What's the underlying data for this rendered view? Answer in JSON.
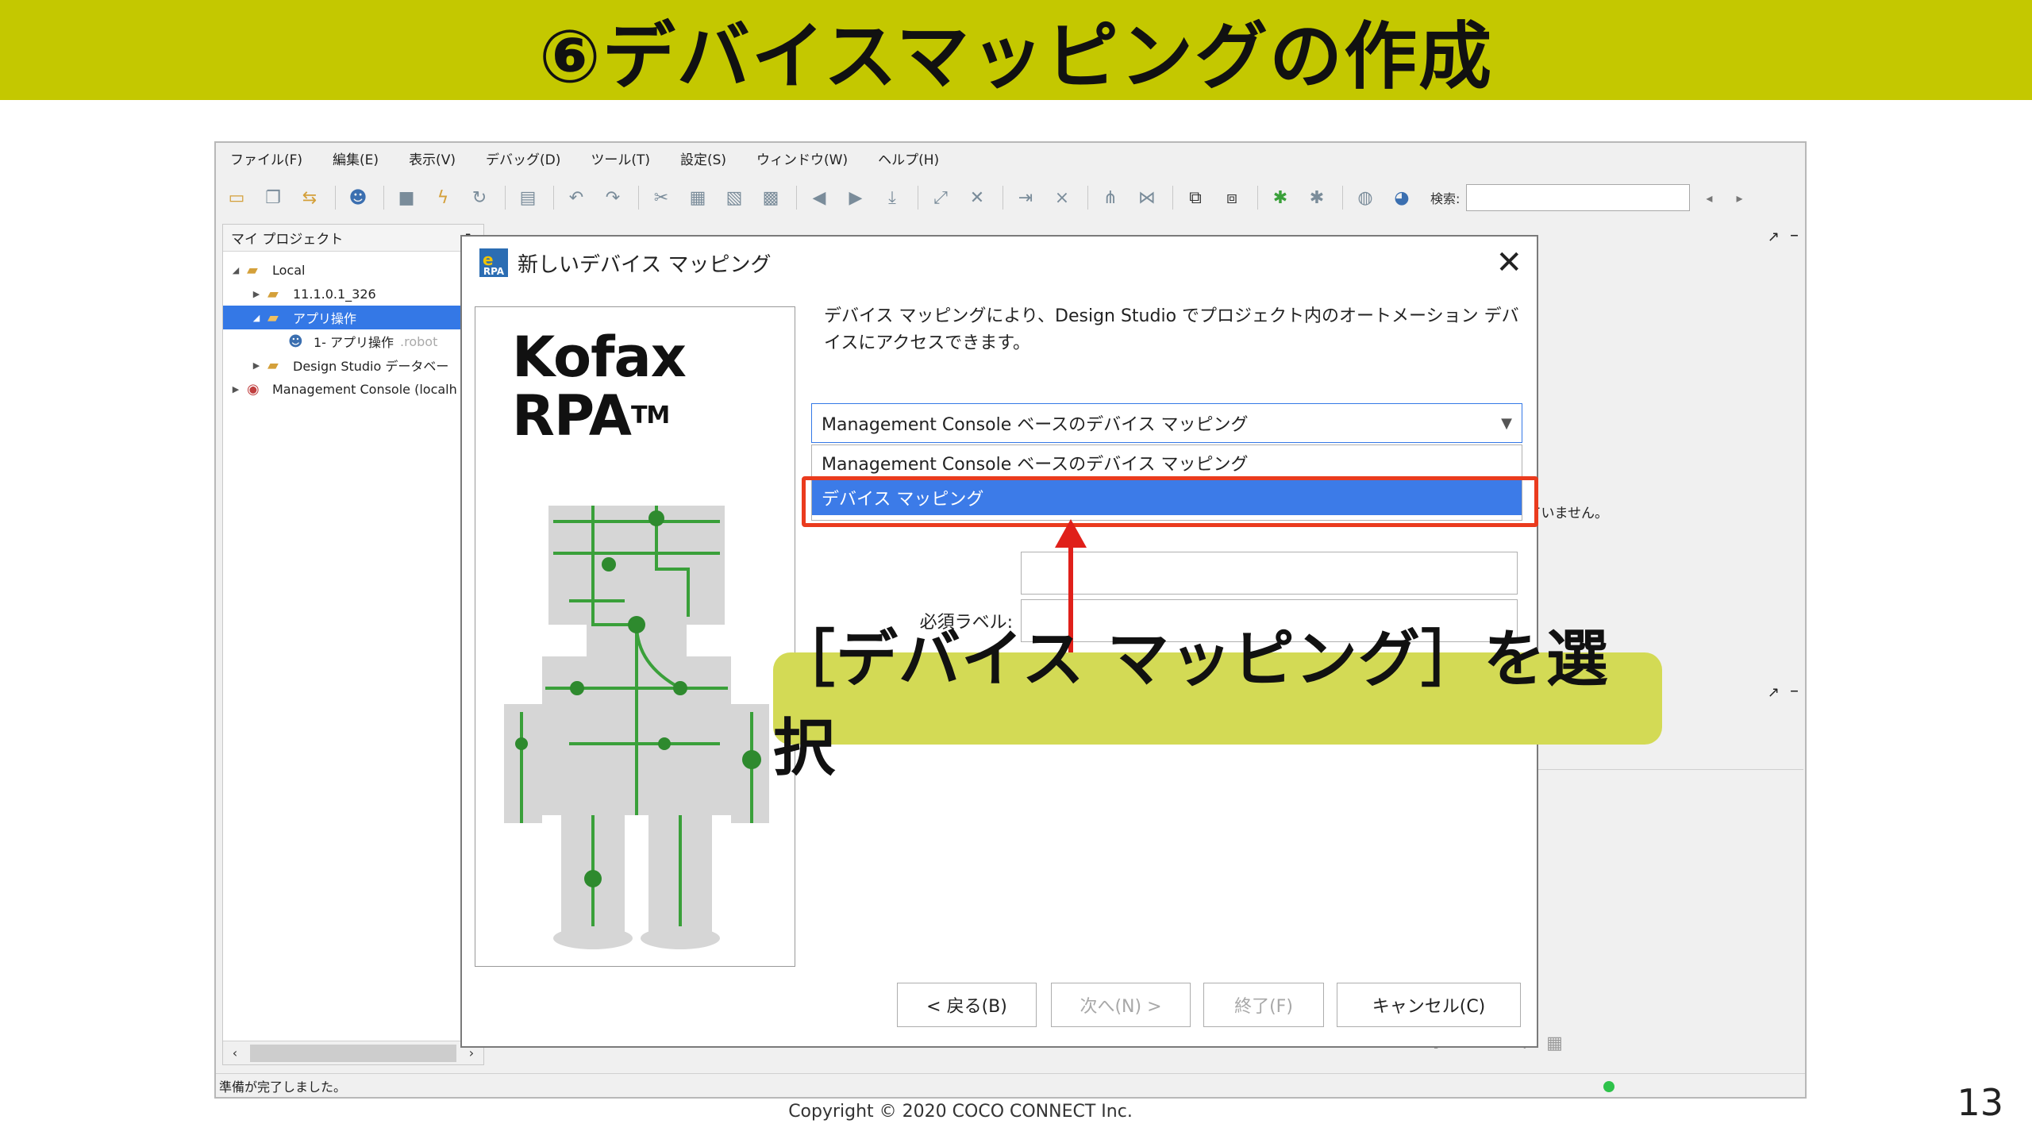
{
  "slide": {
    "title": "⑥デバイスマッピングの作成",
    "copyright": "Copyright © 2020 COCO CONNECT Inc.",
    "page_number": "13",
    "callout": "［デバイス マッピング］を選択"
  },
  "app": {
    "menu": [
      "ファイル(F)",
      "編集(E)",
      "表示(V)",
      "デバッグ(D)",
      "ツール(T)",
      "設定(S)",
      "ウィンドウ(W)",
      "ヘルプ(H)"
    ],
    "search_label": "検索:",
    "left_panel": {
      "title": "マイ プロジェクト",
      "tree": [
        {
          "label": "Local",
          "indent": 0,
          "expanded": true
        },
        {
          "label": "11.1.0.1_326",
          "indent": 1,
          "expanded": false
        },
        {
          "label": "アプリ操作",
          "indent": 1,
          "expanded": true,
          "selected": true
        },
        {
          "label": "1- アプリ操作",
          "suffix": ".robot",
          "indent": 2
        },
        {
          "label": "Design Studio データベー",
          "indent": 1,
          "expanded": false
        },
        {
          "label": "Management Console (localh",
          "indent": 0,
          "expanded": false
        }
      ]
    },
    "right_panel": {
      "message": "たは接続が選択されていません。"
    },
    "status": "準備が完了しました。"
  },
  "dialog": {
    "title": "新しいデバイス マッピング",
    "logo_line1": "Kofax",
    "logo_line2": "RPA",
    "logo_tm": "TM",
    "description": "デバイス マッピングにより、Design Studio でプロジェクト内のオートメーション デバイスにアクセスできます。",
    "select_value": "Management Console ベースのデバイス マッピング",
    "options": [
      "Management Console ベースのデバイス マッピング",
      "デバイス マッピング"
    ],
    "field_label_required": "必須ラベル:",
    "buttons": {
      "back": "< 戻る(B)",
      "next": "次へ(N) >",
      "finish": "終了(F)",
      "cancel": "キャンセル(C)"
    }
  },
  "colors": {
    "title_band": "#c4c800",
    "callout_bg": "#d3da55",
    "highlight": "#ea3b1e",
    "selection": "#3c7be8"
  }
}
